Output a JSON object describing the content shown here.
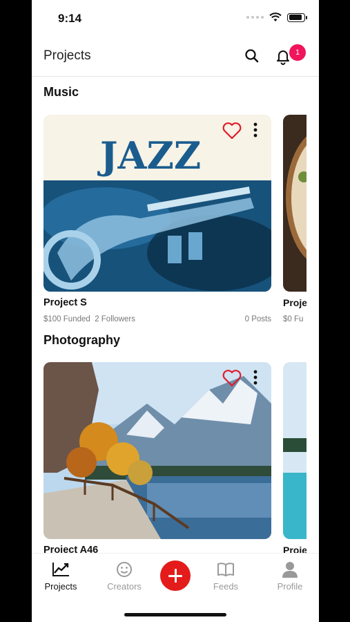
{
  "status_bar": {
    "time": "9:14"
  },
  "header": {
    "title": "Projects",
    "notification_count": "1"
  },
  "sections": [
    {
      "title": "Music",
      "card": {
        "name": "Project S",
        "funded": "$100 Funded",
        "followers": "2 Followers",
        "posts": "0 Posts",
        "image_text": "JAZZ"
      },
      "peek": {
        "name": "Proje",
        "meta": "$0 Fu"
      }
    },
    {
      "title": "Photography",
      "card": {
        "name": "Project A46"
      },
      "peek": {
        "name": "Proje"
      }
    }
  ],
  "tabbar": {
    "projects": "Projects",
    "creators": "Creators",
    "feeds": "Feeds",
    "profile": "Profile"
  },
  "colors": {
    "accent": "#e41b1b",
    "badge": "#f0145a",
    "heart": "#e0192a"
  },
  "icons": {
    "search": "search-icon",
    "bell": "bell-icon",
    "heart": "heart-icon",
    "more": "more-vertical-icon"
  }
}
